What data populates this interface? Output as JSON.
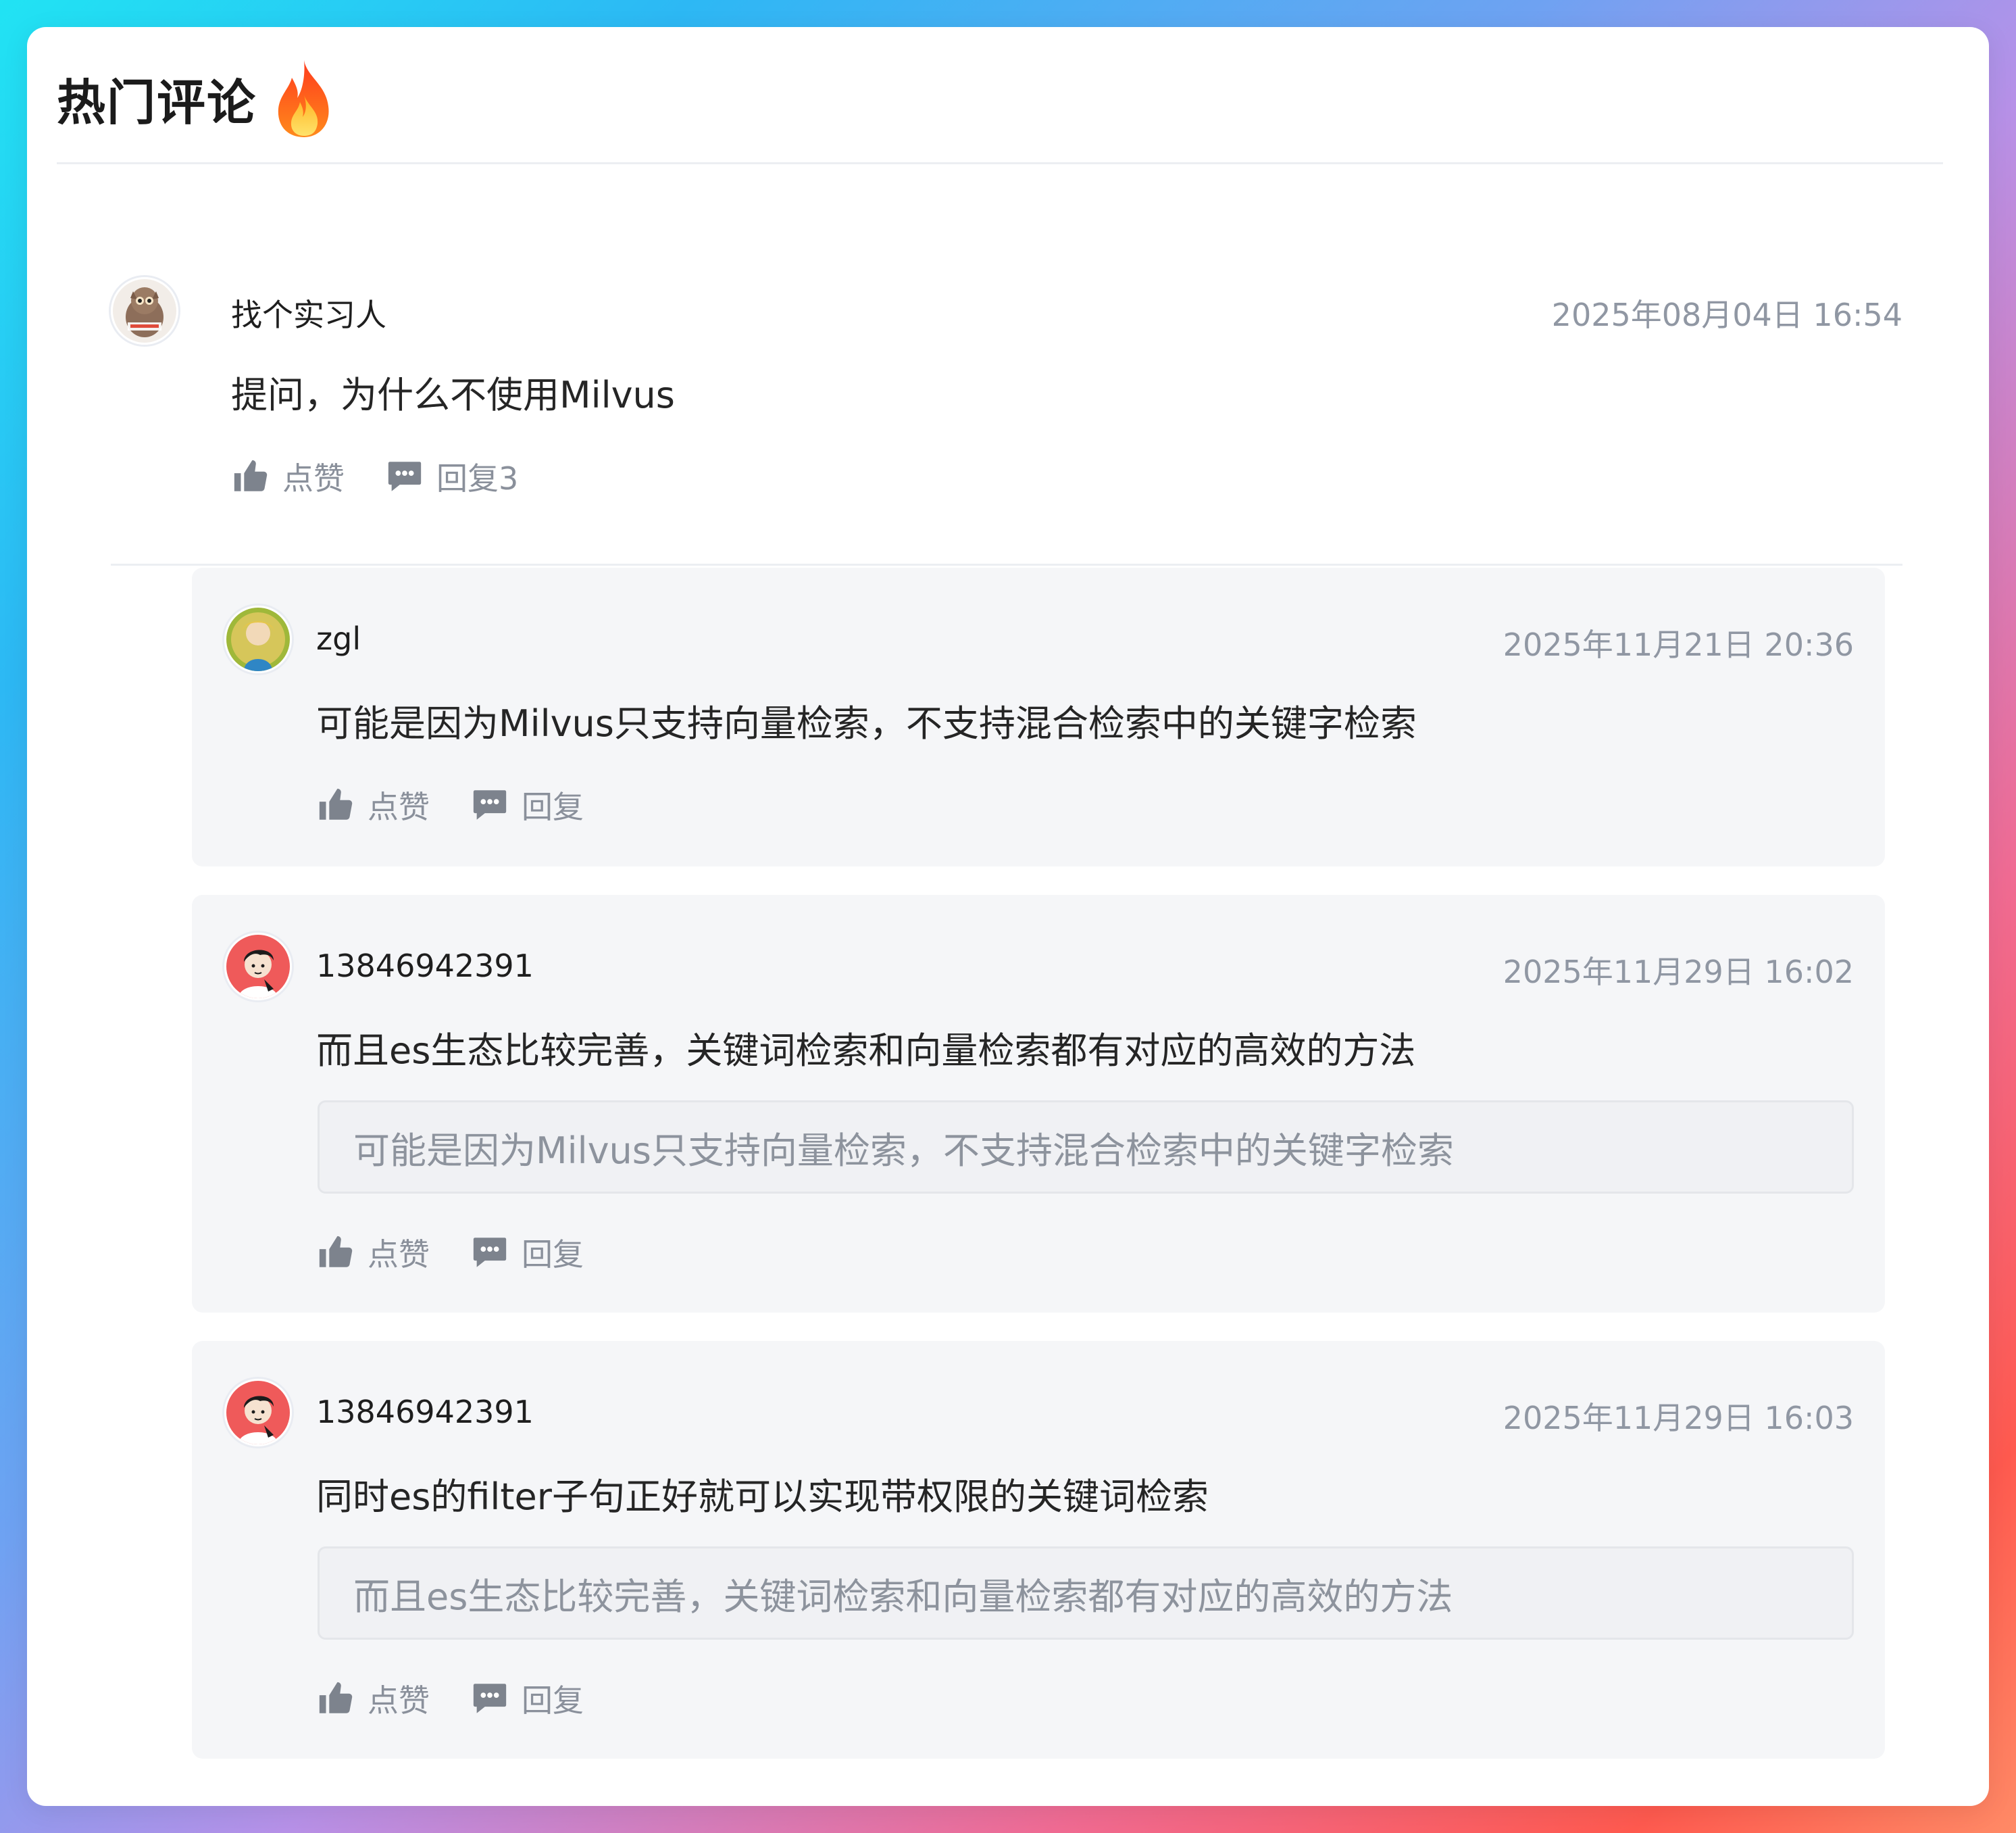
{
  "section": {
    "title": "热门评论",
    "title_icon": "fire-icon"
  },
  "main_comment": {
    "author": "找个实习人",
    "time": "2025年08月04日 16:54",
    "text": "提问，为什么不使用Milvus",
    "like_label": "点赞",
    "reply_label": "回复3",
    "avatar": "owl-avatar"
  },
  "replies": [
    {
      "author": "zgl",
      "time": "2025年11月21日 20:36",
      "text": "可能是因为Milvus只支持向量检索，不支持混合检索中的关键字检索",
      "quote": "",
      "like_label": "点赞",
      "reply_label": "回复",
      "avatar": "blonde-person-avatar"
    },
    {
      "author": "13846942391",
      "time": "2025年11月29日 16:02",
      "text": "而且es生态比较完善，关键词检索和向量检索都有对应的高效的方法",
      "quote": "可能是因为Milvus只支持向量检索，不支持混合检索中的关键字检索",
      "like_label": "点赞",
      "reply_label": "回复",
      "avatar": "cartoon-man-avatar"
    },
    {
      "author": "13846942391",
      "time": "2025年11月29日 16:03",
      "text": "同时es的filter子句正好就可以实现带权限的关键词检索",
      "quote": "而且es生态比较完善，关键词检索和向量检索都有对应的高效的方法",
      "like_label": "点赞",
      "reply_label": "回复",
      "avatar": "cartoon-man-avatar"
    }
  ],
  "colors": {
    "card_bg": "#ffffff",
    "reply_bg": "#f5f6f8",
    "quote_bg": "#f0f1f4",
    "muted_text": "#8a909b",
    "primary_text": "#252525"
  }
}
